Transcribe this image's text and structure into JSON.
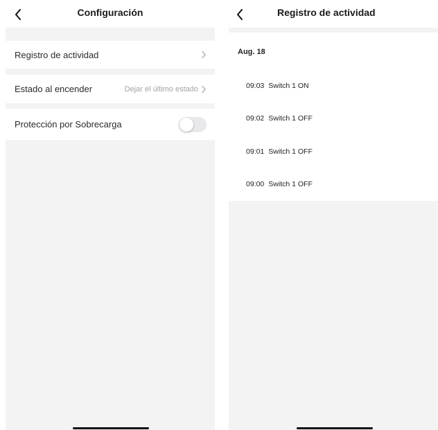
{
  "settings": {
    "title": "Configuración",
    "rows": {
      "activity_log": {
        "label": "Registro de actividad"
      },
      "power_on_state": {
        "label": "Estado al encender",
        "value": "Dejar el último estado"
      },
      "overload_protection": {
        "label": "Protección por Sobrecarga",
        "enabled": false
      }
    }
  },
  "activity": {
    "title": "Registro de actividad",
    "date": "Aug. 18",
    "entries": [
      {
        "time": "09:03",
        "event": "Switch 1 ON"
      },
      {
        "time": "09:02",
        "event": "Switch 1 OFF"
      },
      {
        "time": "09:01",
        "event": "Switch 1 OFF"
      },
      {
        "time": "09:00",
        "event": "Switch 1 OFF"
      }
    ]
  },
  "icons": {
    "back": "chevron-left-icon",
    "disclosure": "chevron-right-icon"
  },
  "colors": {
    "background": "#f3f3f3",
    "surface": "#ffffff",
    "secondary_text": "#a3a3a3",
    "toggle_off": "#e9e9eb"
  }
}
